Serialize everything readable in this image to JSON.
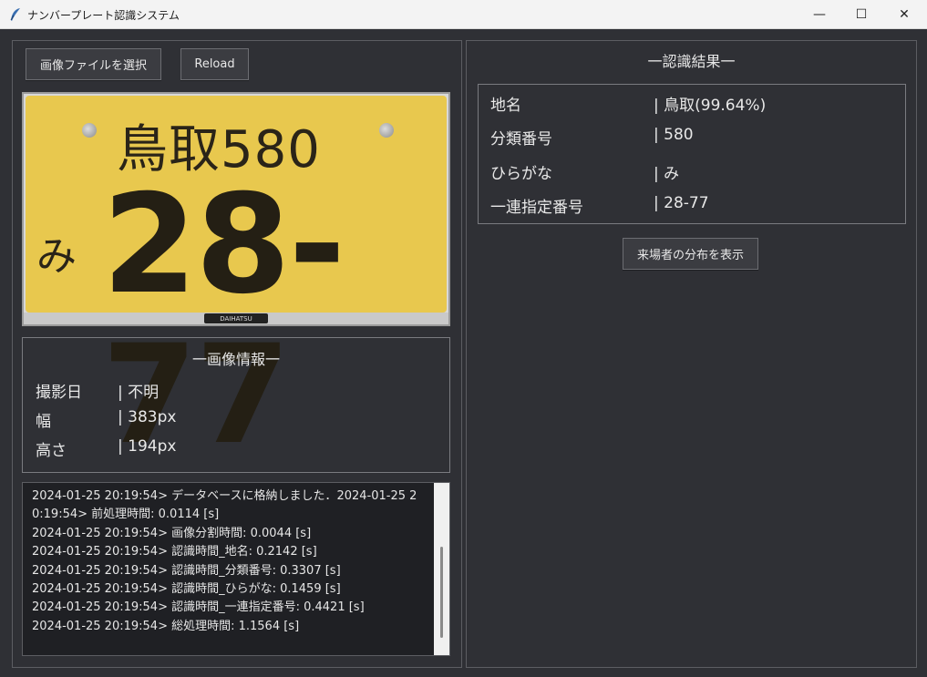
{
  "window": {
    "title": "ナンバープレート認識システム",
    "min_glyph": "—",
    "max_glyph": "☐",
    "close_glyph": "✕"
  },
  "toolbar": {
    "select_label": "画像ファイルを選択",
    "reload_label": "Reload"
  },
  "plate": {
    "region_class": "鳥取580",
    "hiragana": "み",
    "number": "28-77",
    "brand": "DAIHATSU"
  },
  "image_info": {
    "heading": "一画像情報一",
    "rows": [
      {
        "key": "撮影日",
        "value": "| 不明"
      },
      {
        "key": "幅",
        "value": "| 383px"
      },
      {
        "key": "高さ",
        "value": "| 194px"
      }
    ]
  },
  "log": {
    "lines": [
      "2024-01-25 20:19:54> データベースに格納しました．2024-01-25 2",
      "0:19:54> 前処理時間: 0.0114 [s]",
      "2024-01-25 20:19:54> 画像分割時間: 0.0044 [s]",
      "2024-01-25 20:19:54> 認識時間_地名: 0.2142 [s]",
      "2024-01-25 20:19:54> 認識時間_分類番号: 0.3307 [s]",
      "2024-01-25 20:19:54> 認識時間_ひらがな: 0.1459 [s]",
      "2024-01-25 20:19:54> 認識時間_一連指定番号: 0.4421 [s]",
      "2024-01-25 20:19:54> 総処理時間: 1.1564 [s]"
    ]
  },
  "result": {
    "heading": "一認識結果一",
    "rows": [
      {
        "key": "地名",
        "value": "| 鳥取(99.64%)"
      },
      {
        "key": "分類番号",
        "value": "| 580"
      },
      {
        "key": "ひらがな",
        "value": "| み"
      },
      {
        "key": "一連指定番号",
        "value": "| 28-77"
      }
    ],
    "distribution_button": "来場者の分布を表示"
  },
  "colors": {
    "background": "#2f3035",
    "plate": "#e8c84e"
  }
}
